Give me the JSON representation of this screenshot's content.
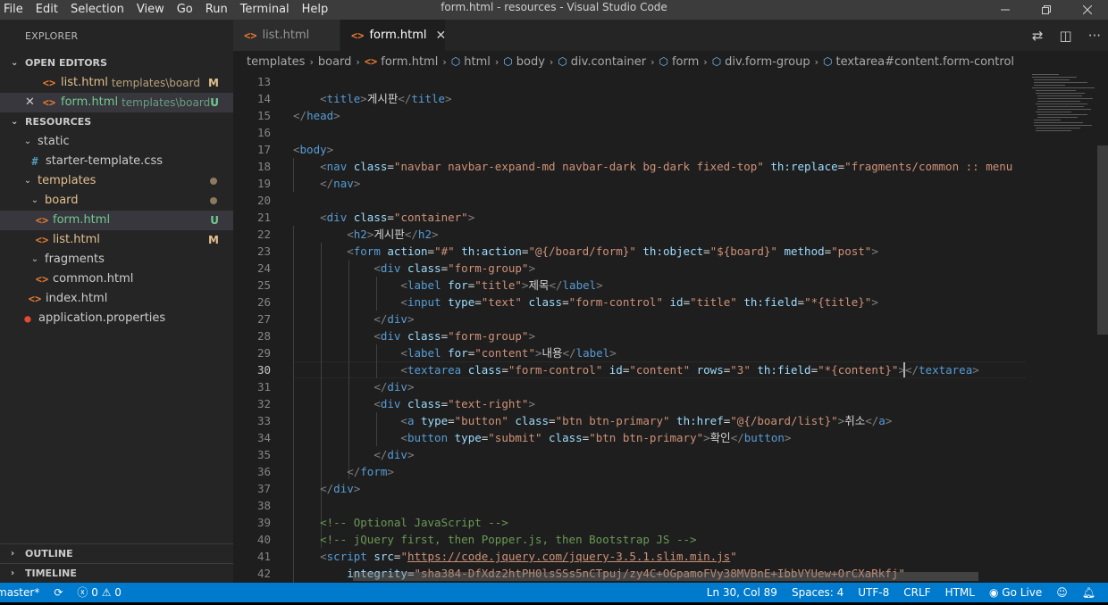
{
  "menu": [
    "File",
    "Edit",
    "Selection",
    "View",
    "Go",
    "Run",
    "Terminal",
    "Help"
  ],
  "window_title": "form.html - resources - Visual Studio Code",
  "sidebar": {
    "header": "EXPLORER",
    "open_editors_title": "OPEN EDITORS",
    "open_editors": [
      {
        "name": "list.html",
        "desc": "templates\\board",
        "badge": "M"
      },
      {
        "name": "form.html",
        "desc": "templates\\board",
        "badge": "U"
      }
    ],
    "resources_title": "RESOURCES",
    "tree": [
      {
        "name": "static",
        "kind": "folder-open",
        "depth": 1
      },
      {
        "name": "starter-template.css",
        "kind": "css",
        "depth": 2
      },
      {
        "name": "templates",
        "kind": "folder-open",
        "depth": 1
      },
      {
        "name": "board",
        "kind": "folder-open",
        "depth": 2
      },
      {
        "name": "form.html",
        "kind": "html",
        "depth": 3,
        "badge": "U"
      },
      {
        "name": "list.html",
        "kind": "html",
        "depth": 3,
        "badge": "M"
      },
      {
        "name": "fragments",
        "kind": "folder-open",
        "depth": 2
      },
      {
        "name": "common.html",
        "kind": "html",
        "depth": 3
      },
      {
        "name": "index.html",
        "kind": "html",
        "depth": 2
      },
      {
        "name": "application.properties",
        "kind": "props",
        "depth": 1
      }
    ],
    "outline_title": "OUTLINE",
    "timeline_title": "TIMELINE"
  },
  "tabs": [
    {
      "label": "list.html",
      "active": false
    },
    {
      "label": "form.html",
      "active": true
    }
  ],
  "breadcrumb": [
    "templates",
    "board",
    "form.html",
    "html",
    "body",
    "div.container",
    "form",
    "div.form-group",
    "textarea#content.form-control"
  ],
  "code": {
    "line_numbers": [
      "13",
      "14",
      "15",
      "16",
      "17",
      "18",
      "19",
      "20",
      "21",
      "22",
      "23",
      "24",
      "25",
      "26",
      "27",
      "28",
      "29",
      "30",
      "31",
      "32",
      "33",
      "34",
      "35",
      "36",
      "37",
      "38",
      "39",
      "40",
      "41",
      "42"
    ],
    "l14_title": "게시판",
    "l22_h2": "게시판",
    "l25_label": "제목",
    "l29_label": "내용",
    "l33_link": "취소",
    "l34_button": "확인",
    "l18_navclass": "\"navbar navbar-expand-md navbar-dark bg-dark fixed-top\"",
    "l18_replace": "\"fragments/common :: menu",
    "l23_action": "\"#\"",
    "l23_thaction": "\"@{/board/form}\"",
    "l23_object": "\"${board}\"",
    "l23_method": "\"post\"",
    "l39_comment": "<!-- Optional JavaScript -->",
    "l40_comment": "<!-- jQuery first, then Popper.js, then Bootstrap JS -->",
    "l41_src": "https://code.jquery.com/jquery-3.5.1.slim.min.js",
    "l42_integrity": "\"sha384-DfXdz2htPH0lsSSs5nCTpuj/zy4C+OGpamoFVy38MVBnE+IbbVYUew+OrCXaRkfj\""
  },
  "status": {
    "branch": "master*",
    "errors": "0",
    "warnings": "0",
    "position": "Ln 30, Col 89",
    "spaces": "Spaces: 4",
    "encoding": "UTF-8",
    "eol": "CRLF",
    "language": "HTML",
    "golive": "Go Live"
  }
}
